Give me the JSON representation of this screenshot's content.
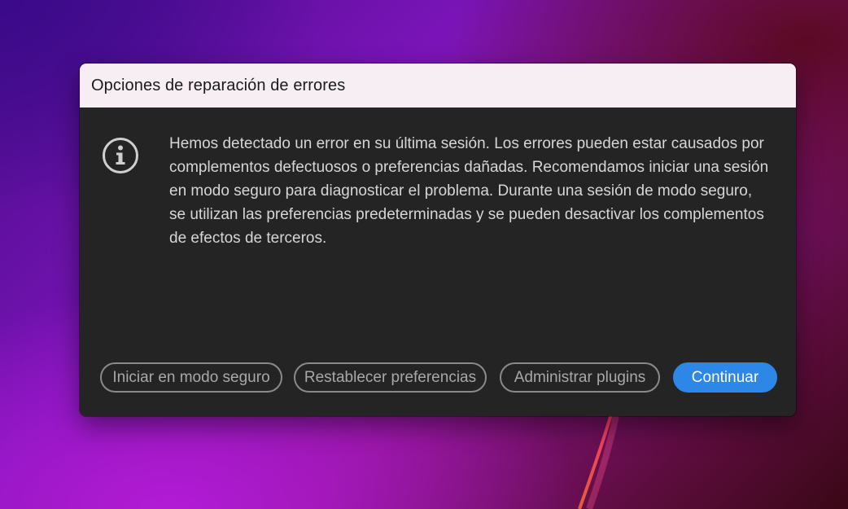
{
  "dialog": {
    "title": "Opciones de reparación de errores",
    "icon": "info-icon",
    "message": "Hemos detectado un error en su última sesión. Los errores pueden estar causados por complementos defectuosos o preferencias dañadas. Recomendamos iniciar una sesión en modo seguro para diagnosticar el problema. Durante una sesión de modo seguro, se utilizan las preferencias predeterminadas y se pueden desactivar los complementos de efectos de terceros.",
    "buttons": {
      "safe_mode": "Iniciar en modo seguro",
      "reset_prefs": "Restablecer preferencias",
      "manage_plugins": "Administrar plugins",
      "continue": "Continuar"
    }
  },
  "colors": {
    "dialog_bg": "#242424",
    "title_bar_bg": "#f7eef4",
    "primary_button": "#2d87e6",
    "secondary_border": "#8a8a8a",
    "text": "#d6d6d6"
  }
}
